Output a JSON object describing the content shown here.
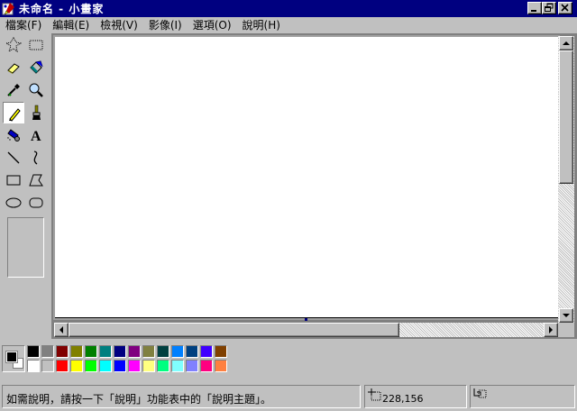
{
  "window": {
    "title": "未命名 - 小畫家"
  },
  "menu": [
    "檔案(F)",
    "編輯(E)",
    "檢視(V)",
    "影像(I)",
    "選項(O)",
    "說明(H)"
  ],
  "tools": [
    "free-form-select-icon",
    "rectangle-select-icon",
    "eraser-icon",
    "fill-bucket-icon",
    "color-picker-icon",
    "magnifier-icon",
    "pencil-icon",
    "brush-icon",
    "airbrush-icon",
    "text-icon",
    "line-icon",
    "curve-icon",
    "rectangle-icon",
    "polygon-icon",
    "ellipse-icon",
    "rounded-rectangle-icon"
  ],
  "active_tool": "pencil-icon",
  "colors": {
    "foreground": "#000000",
    "background": "#ffffff",
    "palette_top": [
      "#000000",
      "#808080",
      "#800000",
      "#808000",
      "#008000",
      "#008080",
      "#000080",
      "#800080",
      "#808040",
      "#004040",
      "#0080ff",
      "#004080",
      "#4000ff",
      "#804000"
    ],
    "palette_bottom": [
      "#ffffff",
      "#c0c0c0",
      "#ff0000",
      "#ffff00",
      "#00ff00",
      "#00ffff",
      "#0000ff",
      "#ff00ff",
      "#ffff80",
      "#00ff80",
      "#80ffff",
      "#8080ff",
      "#ff0080",
      "#ff8040"
    ]
  },
  "status": {
    "message": "如需說明，請按一下「說明」功能表中的「說明主題」。",
    "coordinates": "228,156",
    "size": ""
  }
}
